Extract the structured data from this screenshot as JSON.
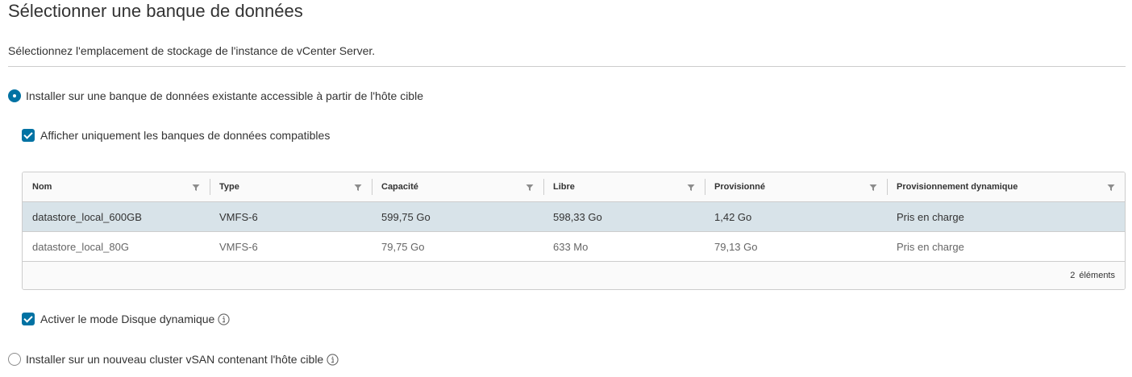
{
  "page": {
    "title": "Sélectionner une banque de données",
    "subtitle": "Sélectionnez l'emplacement de stockage de l'instance de vCenter Server."
  },
  "options": {
    "existing_datastore": {
      "label": "Installer sur une banque de données existante accessible à partir de l'hôte cible",
      "selected": true
    },
    "compatible_only": {
      "label": "Afficher uniquement les banques de données compatibles",
      "checked": true
    },
    "thin_disk": {
      "label": "Activer le mode Disque dynamique",
      "checked": true,
      "icon": "info-icon"
    },
    "vsan_cluster": {
      "label": "Installer sur un nouveau cluster vSAN contenant l'hôte cible",
      "selected": false,
      "icon": "info-icon"
    }
  },
  "table": {
    "columns": [
      "Nom",
      "Type",
      "Capacité",
      "Libre",
      "Provisionné",
      "Provisionnement dynamique"
    ],
    "rows": [
      [
        "datastore_local_600GB",
        "VMFS-6",
        "599,75 Go",
        "598,33 Go",
        "1,42 Go",
        "Pris en charge"
      ],
      [
        "datastore_local_80G",
        "VMFS-6",
        "79,75 Go",
        "633 Mo",
        "79,13 Go",
        "Pris en charge"
      ]
    ],
    "selected_row": 0,
    "footer": {
      "count": "2",
      "label": "éléments"
    }
  },
  "colors": {
    "accent": "#0072a3",
    "selected_row": "#d8e3e9",
    "border": "#cccccc"
  }
}
